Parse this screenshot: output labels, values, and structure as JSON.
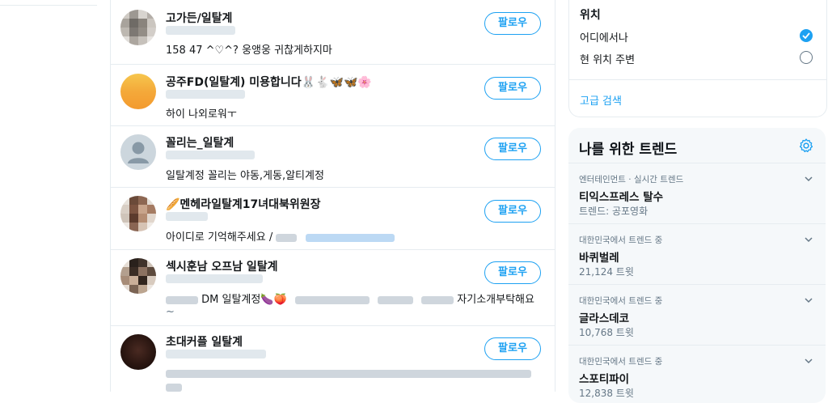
{
  "accounts": [
    {
      "name": "고가든/일탈계",
      "bio": "158 47 ^♡^? 웅앵웅 귀찮게하지마",
      "follow": "팔로우"
    },
    {
      "name": "공주FD(일탈계) 미용합니다🐰🐇🦋🦋🌸",
      "bio": "하이 나외로워ㅜ",
      "follow": "팔로우"
    },
    {
      "name": "꼴리는_일탈계",
      "bio": "일탈계정 꼴리는 야동,게동,알티계정",
      "follow": "팔로우"
    },
    {
      "name": "🥖멘헤라일탈계17녀대북위원장",
      "bio": "아이디로 기억해주세요 /",
      "follow": "팔로우"
    },
    {
      "name": "섹시훈남 오프남 일탈계",
      "bio": "DM 일탈계정🍆🍑",
      "bio_tail": "자기소개부탁해요",
      "bio_line2": "~",
      "follow": "팔로우"
    },
    {
      "name": "초대커플 일탈계",
      "follow": "팔로우"
    }
  ],
  "location": {
    "title": "위치",
    "option_anywhere": "어디에서나",
    "option_nearby": "현 위치 주변",
    "advanced_search": "고급 검색"
  },
  "trends": {
    "title": "나를 위한 트렌드",
    "items": [
      {
        "context": "엔터테인먼트 · 실시간 트렌드",
        "name": "티익스프레스 탈수",
        "sub": "트렌드: 공포영화"
      },
      {
        "context": "대한민국에서 트렌드 중",
        "name": "바퀴벌레",
        "sub": "21,124 트윗"
      },
      {
        "context": "대한민국에서 트렌드 중",
        "name": "글라스데코",
        "sub": "10,768 트윗"
      },
      {
        "context": "대한민국에서 트렌드 중",
        "name": "스포티파이",
        "sub": "12,838 트윗"
      }
    ]
  },
  "colors": {
    "accent": "#1da1f2",
    "border": "#e6ecf0",
    "muted": "#657786",
    "panel": "#f5f8fa"
  }
}
